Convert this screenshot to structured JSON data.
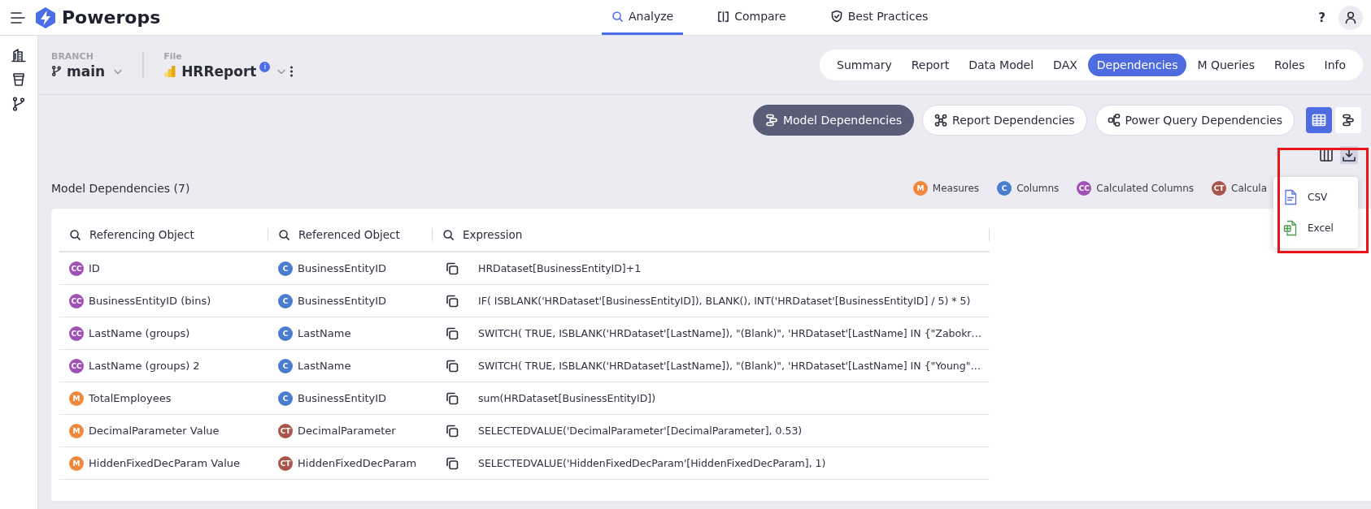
{
  "app": {
    "title": "Powerops"
  },
  "nav": [
    {
      "kind": "search",
      "label": "Analyze",
      "selected": true
    },
    {
      "kind": "compare",
      "label": "Compare",
      "selected": false
    },
    {
      "kind": "shield",
      "label": "Best Practices",
      "selected": false
    }
  ],
  "help": "?",
  "branch": {
    "label": "BRANCH",
    "value": "main"
  },
  "file": {
    "label": "File",
    "value": "HRReport",
    "info": "i"
  },
  "tabs": [
    {
      "label": "Summary",
      "selected": false
    },
    {
      "label": "Report",
      "selected": false
    },
    {
      "label": "Data Model",
      "selected": false
    },
    {
      "label": "DAX",
      "selected": false
    },
    {
      "label": "Dependencies",
      "selected": true
    },
    {
      "label": "M Queries",
      "selected": false
    },
    {
      "label": "Roles",
      "selected": false
    },
    {
      "label": "Info",
      "selected": false
    }
  ],
  "views": [
    {
      "kind": "model",
      "label": "Model Dependencies",
      "selected": true
    },
    {
      "kind": "report",
      "label": "Report Dependencies",
      "selected": false
    },
    {
      "kind": "query",
      "label": "Power Query Dependencies",
      "selected": false
    }
  ],
  "view_modes": [
    {
      "kind": "table",
      "selected": true
    },
    {
      "kind": "tree",
      "selected": false
    }
  ],
  "section": {
    "title": "Model Dependencies (7)"
  },
  "legend": [
    {
      "badge": "M",
      "label": "Measures",
      "color": "#f0883e"
    },
    {
      "badge": "C",
      "label": "Columns",
      "color": "#4a7ccf"
    },
    {
      "badge": "CC",
      "label": "Calculated Columns",
      "color": "#a052b4"
    },
    {
      "badge": "CT",
      "label": "Calcula",
      "color": "#a8564c"
    }
  ],
  "export_menu": {
    "items": [
      {
        "kind": "csv",
        "label": "CSV"
      },
      {
        "kind": "excel",
        "label": "Excel"
      }
    ]
  },
  "table": {
    "columns": [
      "Referencing Object",
      "Referenced Object",
      "Expression"
    ],
    "rows": [
      {
        "referencing": {
          "badge": "CC",
          "color": "#a052b4",
          "name": "ID"
        },
        "referenced": {
          "badge": "C",
          "color": "#4a7ccf",
          "name": "BusinessEntityID"
        },
        "expression": "HRDataset[BusinessEntityID]+1"
      },
      {
        "referencing": {
          "badge": "CC",
          "color": "#a052b4",
          "name": "BusinessEntityID (bins)"
        },
        "referenced": {
          "badge": "C",
          "color": "#4a7ccf",
          "name": "BusinessEntityID"
        },
        "expression": "IF( ISBLANK('HRDataset'[BusinessEntityID]), BLANK(), INT('HRDataset'[BusinessEntityID] / 5) * 5)"
      },
      {
        "referencing": {
          "badge": "CC",
          "color": "#a052b4",
          "name": "LastName (groups)"
        },
        "referenced": {
          "badge": "C",
          "color": "#4a7ccf",
          "name": "LastName"
        },
        "expression": "SWITCH( TRUE, ISBLANK('HRDataset'[LastName]), \"(Blank)\", 'HRDataset'[LastName] IN {\"Zabokr…"
      },
      {
        "referencing": {
          "badge": "CC",
          "color": "#a052b4",
          "name": "LastName (groups) 2"
        },
        "referenced": {
          "badge": "C",
          "color": "#4a7ccf",
          "name": "LastName"
        },
        "expression": "SWITCH( TRUE, ISBLANK('HRDataset'[LastName]), \"(Blank)\", 'HRDataset'[LastName] IN {\"Young\"…"
      },
      {
        "referencing": {
          "badge": "M",
          "color": "#f0883e",
          "name": "TotalEmployees"
        },
        "referenced": {
          "badge": "C",
          "color": "#4a7ccf",
          "name": "BusinessEntityID"
        },
        "expression": "sum(HRDataset[BusinessEntityID])"
      },
      {
        "referencing": {
          "badge": "M",
          "color": "#f0883e",
          "name": "DecimalParameter Value"
        },
        "referenced": {
          "badge": "CT",
          "color": "#a8564c",
          "name": "DecimalParameter"
        },
        "expression": "SELECTEDVALUE('DecimalParameter'[DecimalParameter], 0.53)"
      },
      {
        "referencing": {
          "badge": "M",
          "color": "#f0883e",
          "name": "HiddenFixedDecParam Value"
        },
        "referenced": {
          "badge": "CT",
          "color": "#a8564c",
          "name": "HiddenFixedDecParam"
        },
        "expression": "SELECTEDVALUE('HiddenFixedDecParam'[HiddenFixedDecParam], 1)"
      }
    ]
  }
}
